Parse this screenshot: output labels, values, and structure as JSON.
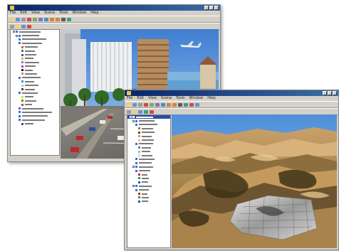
{
  "window_a": {
    "menu": [
      "File",
      "Edit",
      "View",
      "Scene",
      "Tools",
      "Window",
      "Help"
    ]
  },
  "window_b": {
    "menu": [
      "File",
      "Edit",
      "View",
      "Scene",
      "Tools",
      "Window",
      "Help"
    ]
  },
  "colors": {
    "titlebar_start": "#0a246a",
    "titlebar_end": "#3a6ea5",
    "chrome": "#d4d0c8",
    "sky": "#4f8fd8",
    "terrain_light": "#d8b27a",
    "terrain_dark": "#3f3318"
  }
}
